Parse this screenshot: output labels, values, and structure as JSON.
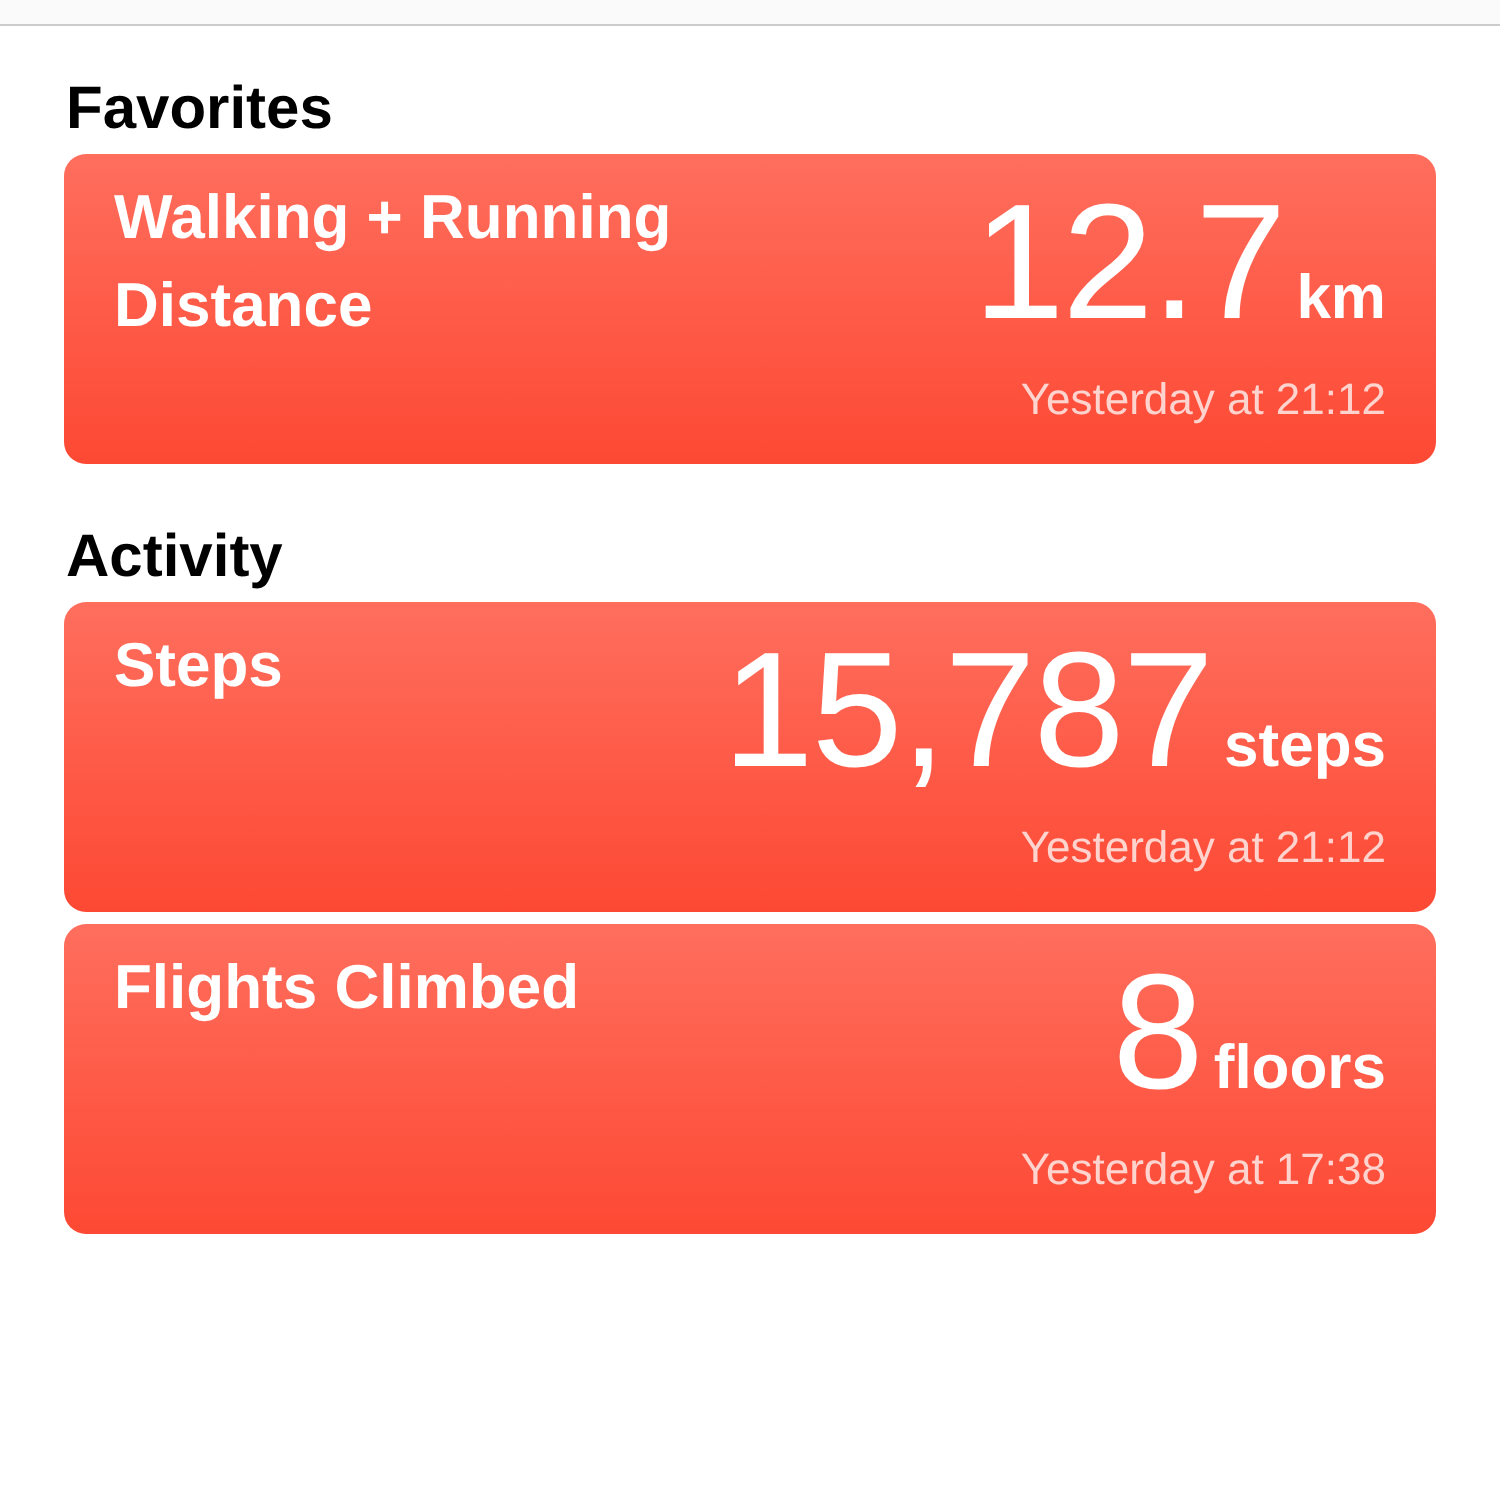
{
  "sections": [
    {
      "title": "Favorites",
      "cards": [
        {
          "title": "Walking + Running Distance",
          "value": "12.7",
          "unit": "km",
          "time": "Yesterday at 21:12"
        }
      ]
    },
    {
      "title": "Activity",
      "cards": [
        {
          "title": "Steps",
          "value": "15,787",
          "unit": "steps",
          "time": "Yesterday at 21:12"
        },
        {
          "title": "Flights Climbed",
          "value": "8",
          "unit": "floors",
          "time": "Yesterday at 17:38"
        }
      ]
    }
  ]
}
